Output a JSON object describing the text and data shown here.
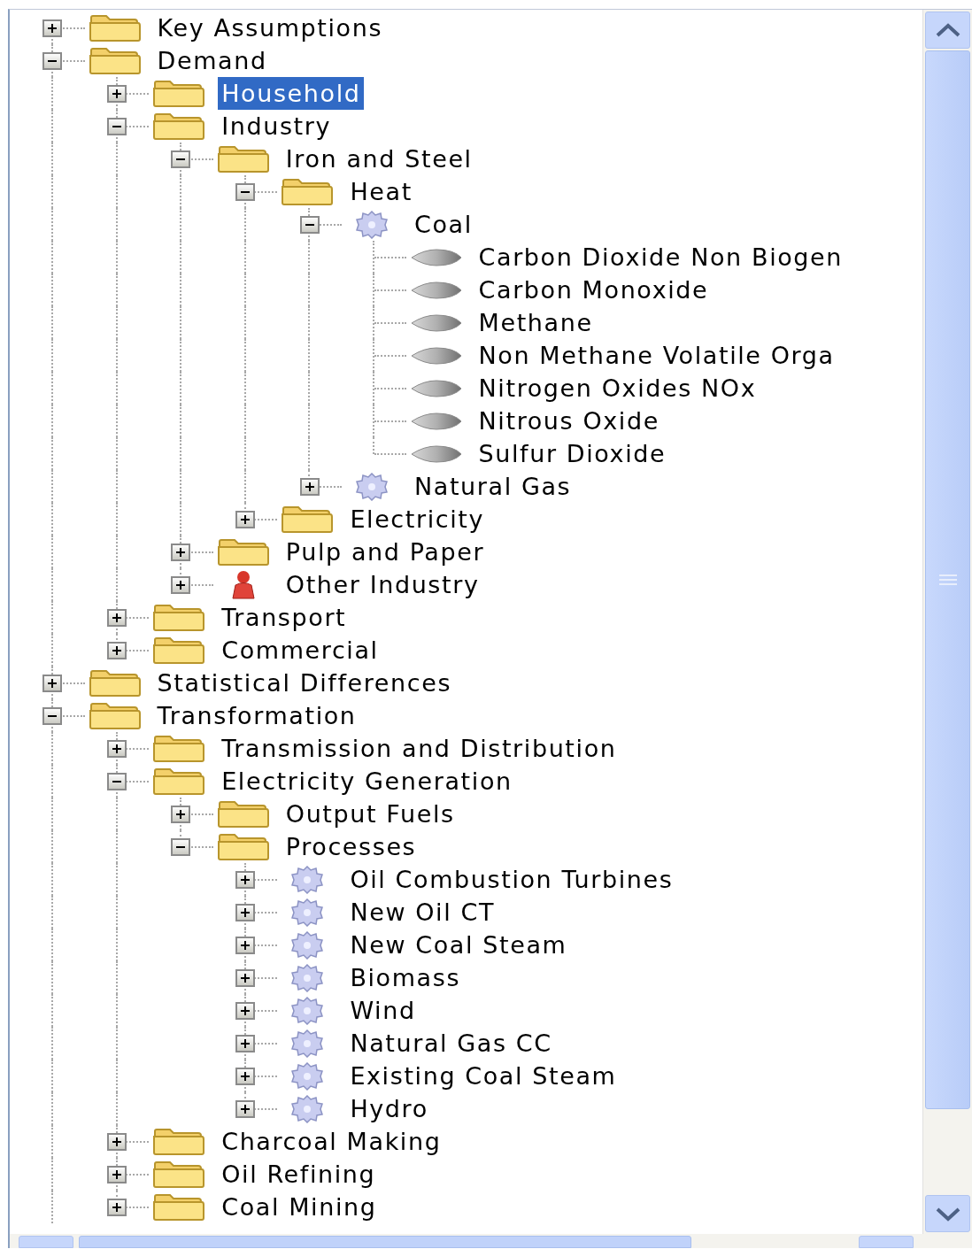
{
  "tree": [
    {
      "label": "Key Assumptions",
      "kind": "folder",
      "expanded": false,
      "selected": false
    },
    {
      "label": "Demand",
      "kind": "folder",
      "expanded": true,
      "selected": false,
      "children": [
        {
          "label": "Household",
          "kind": "folder",
          "expanded": false,
          "selected": true
        },
        {
          "label": "Industry",
          "kind": "folder",
          "expanded": true,
          "selected": false,
          "children": [
            {
              "label": "Iron and Steel",
              "kind": "folder",
              "expanded": true,
              "selected": false,
              "children": [
                {
                  "label": "Heat",
                  "kind": "folder",
                  "expanded": true,
                  "selected": false,
                  "children": [
                    {
                      "label": "Coal",
                      "kind": "gear",
                      "expanded": true,
                      "selected": false,
                      "children": [
                        {
                          "label": "Carbon Dioxide Non Biogen",
                          "kind": "emission",
                          "selected": false
                        },
                        {
                          "label": "Carbon Monoxide",
                          "kind": "emission",
                          "selected": false
                        },
                        {
                          "label": "Methane",
                          "kind": "emission",
                          "selected": false
                        },
                        {
                          "label": "Non Methane Volatile Orga",
                          "kind": "emission",
                          "selected": false
                        },
                        {
                          "label": "Nitrogen Oxides NOx",
                          "kind": "emission",
                          "selected": false
                        },
                        {
                          "label": "Nitrous Oxide",
                          "kind": "emission",
                          "selected": false
                        },
                        {
                          "label": "Sulfur Dioxide",
                          "kind": "emission",
                          "selected": false
                        }
                      ]
                    },
                    {
                      "label": "Natural Gas",
                      "kind": "gear",
                      "expanded": false,
                      "selected": false
                    }
                  ]
                },
                {
                  "label": "Electricity",
                  "kind": "folder",
                  "expanded": false,
                  "selected": false
                }
              ]
            },
            {
              "label": "Pulp and Paper",
              "kind": "folder",
              "expanded": false,
              "selected": false
            },
            {
              "label": "Other Industry",
              "kind": "person",
              "expanded": false,
              "selected": false
            }
          ]
        },
        {
          "label": "Transport",
          "kind": "folder",
          "expanded": false,
          "selected": false
        },
        {
          "label": "Commercial",
          "kind": "folder",
          "expanded": false,
          "selected": false
        }
      ]
    },
    {
      "label": "Statistical Differences",
      "kind": "folder",
      "expanded": false,
      "selected": false
    },
    {
      "label": "Transformation",
      "kind": "folder",
      "expanded": true,
      "selected": false,
      "children": [
        {
          "label": "Transmission and Distribution",
          "kind": "folder",
          "expanded": false,
          "selected": false
        },
        {
          "label": "Electricity Generation",
          "kind": "folder",
          "expanded": true,
          "selected": false,
          "children": [
            {
              "label": "Output Fuels",
              "kind": "folder",
              "expanded": false,
              "selected": false
            },
            {
              "label": "Processes",
              "kind": "folder",
              "expanded": true,
              "selected": false,
              "children": [
                {
                  "label": "Oil Combustion Turbines",
                  "kind": "gear",
                  "expanded": false,
                  "selected": false
                },
                {
                  "label": "New Oil CT",
                  "kind": "gear",
                  "expanded": false,
                  "selected": false
                },
                {
                  "label": "New Coal Steam",
                  "kind": "gear",
                  "expanded": false,
                  "selected": false
                },
                {
                  "label": "Biomass",
                  "kind": "gear",
                  "expanded": false,
                  "selected": false
                },
                {
                  "label": "Wind",
                  "kind": "gear",
                  "expanded": false,
                  "selected": false
                },
                {
                  "label": "Natural Gas CC",
                  "kind": "gear",
                  "expanded": false,
                  "selected": false
                },
                {
                  "label": "Existing Coal Steam",
                  "kind": "gear",
                  "expanded": false,
                  "selected": false
                },
                {
                  "label": "Hydro",
                  "kind": "gear",
                  "expanded": false,
                  "selected": false
                }
              ]
            }
          ]
        },
        {
          "label": "Charcoal Making",
          "kind": "folder",
          "expanded": false,
          "selected": false
        },
        {
          "label": "Oil Refining",
          "kind": "folder",
          "expanded": false,
          "selected": false
        },
        {
          "label": "Coal Mining",
          "kind": "folder",
          "expanded": false,
          "selected": false
        }
      ]
    }
  ]
}
